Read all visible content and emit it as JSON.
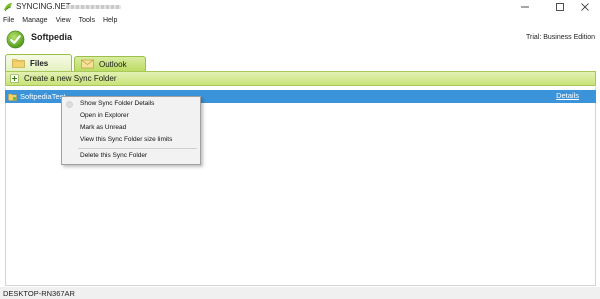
{
  "window": {
    "title": "SYNCING.NET -",
    "controls": [
      "minimize-icon",
      "maximize-icon",
      "close-icon"
    ]
  },
  "menu": [
    "File",
    "Manage",
    "View",
    "Tools",
    "Help"
  ],
  "header": {
    "account_name": "Softpedia",
    "edition": "Trial: Business Edition",
    "status_icon": "check-circle-icon"
  },
  "tabs": [
    {
      "label": "Files",
      "icon": "folder-icon",
      "active": true
    },
    {
      "label": "Outlook",
      "icon": "envelope-icon",
      "active": false
    }
  ],
  "create_folder_label": "Create a new Sync Folder",
  "folders": [
    {
      "name": "SoftpediaTest",
      "details_label": "Details",
      "selected": true
    }
  ],
  "context_menu": [
    "Show Sync Folder Details",
    "Open in Explorer",
    "Mark as Unread",
    "View this Sync Folder size limits",
    "Delete this Sync Folder"
  ],
  "status_bar": "DESKTOP-RN367AR",
  "colors": {
    "accent_green": "#bcdc63",
    "selection_blue": "#3b94d9"
  }
}
